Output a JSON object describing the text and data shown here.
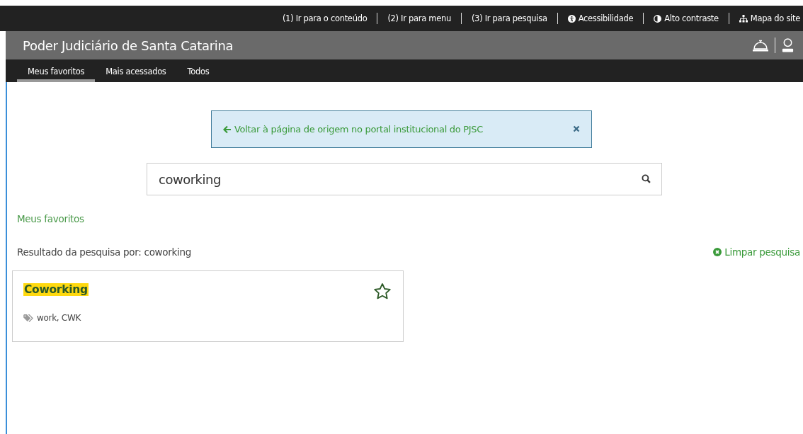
{
  "top_links": [
    {
      "kind": "text",
      "label": "(1) Ir para o conteúdo"
    },
    {
      "kind": "text",
      "label": "(2) Ir para menu"
    },
    {
      "kind": "text",
      "label": "(3) Ir para pesquisa"
    },
    {
      "kind": "accessibility",
      "label": "Acessibilidade"
    },
    {
      "kind": "contrast",
      "label": "Alto contraste"
    },
    {
      "kind": "sitemap",
      "label": "Mapa do site"
    }
  ],
  "header": {
    "title": "Poder Judiciário de Santa Catarina"
  },
  "tabs": [
    {
      "label": "Meus favoritos",
      "selected": true
    },
    {
      "label": "Mais acessados",
      "selected": false
    },
    {
      "label": "Todos",
      "selected": false
    }
  ],
  "back_alert": {
    "text": "Voltar à página de origem no portal institucional do PJSC"
  },
  "search": {
    "value": "coworking"
  },
  "section_link": "Meus favoritos",
  "result_label": "Resultado da pesquisa por: coworking",
  "clear_search": "Limpar pesquisa",
  "results": [
    {
      "title": "Coworking",
      "tags": "work, CWK",
      "favorite": false
    }
  ]
}
